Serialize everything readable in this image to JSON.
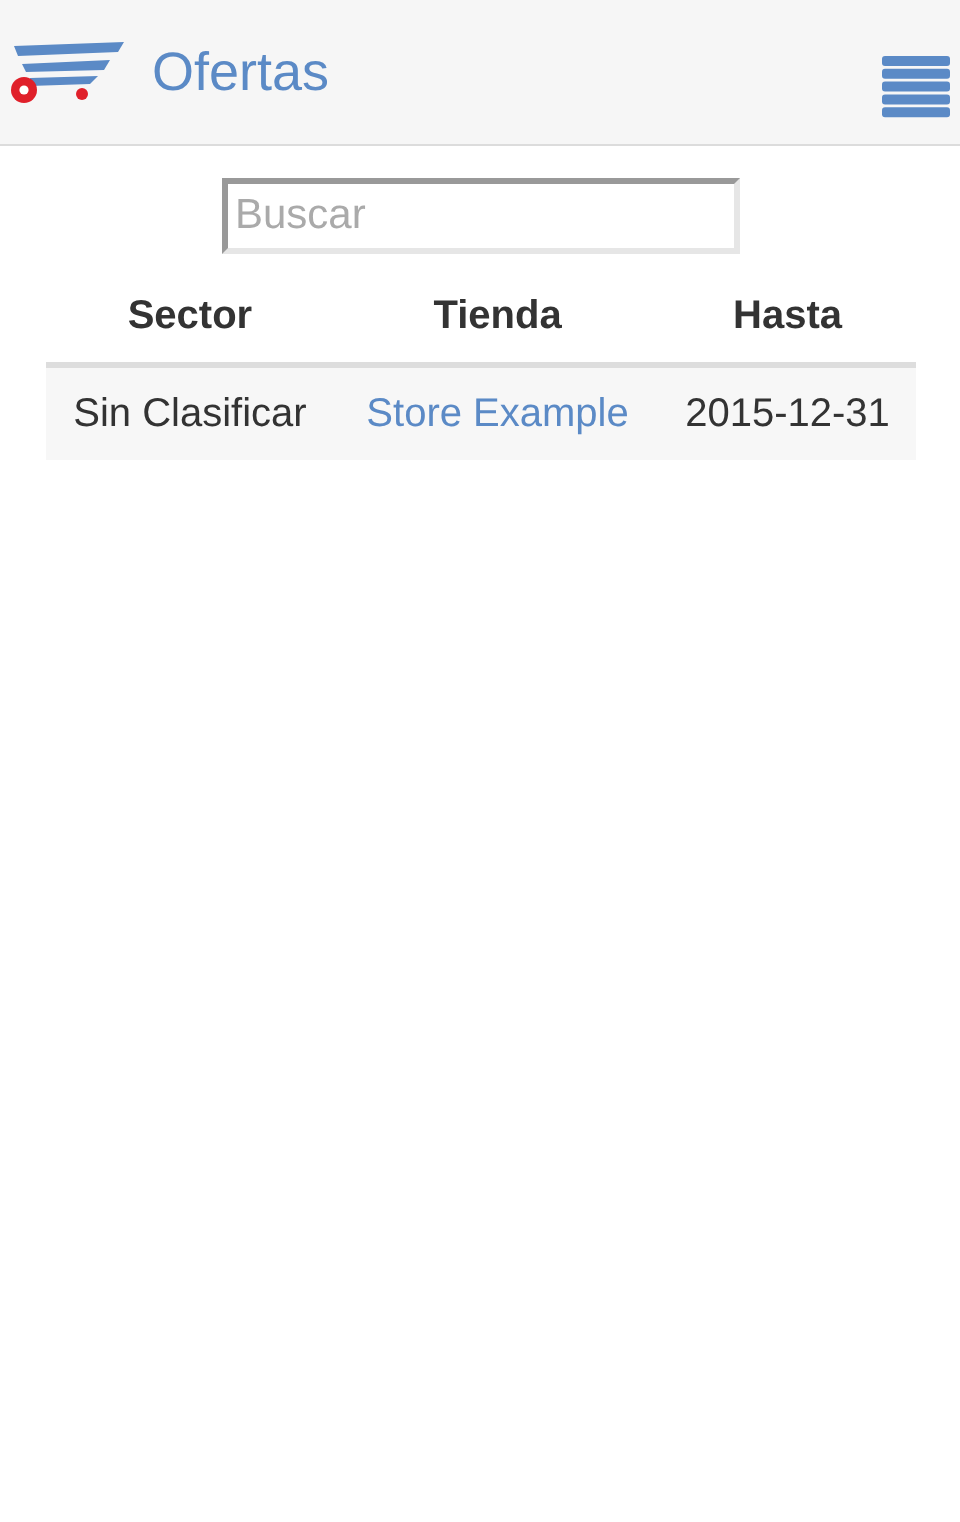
{
  "header": {
    "title": "Ofertas"
  },
  "search": {
    "placeholder": "Buscar"
  },
  "table": {
    "columns": [
      "Sector",
      "Tienda",
      "Hasta"
    ],
    "rows": [
      {
        "cells": [
          {
            "text": "Sin Clasificar",
            "kind": "text"
          },
          {
            "text": "Store Example",
            "kind": "link"
          },
          {
            "text": "2015-12-31",
            "kind": "text"
          }
        ]
      }
    ]
  }
}
